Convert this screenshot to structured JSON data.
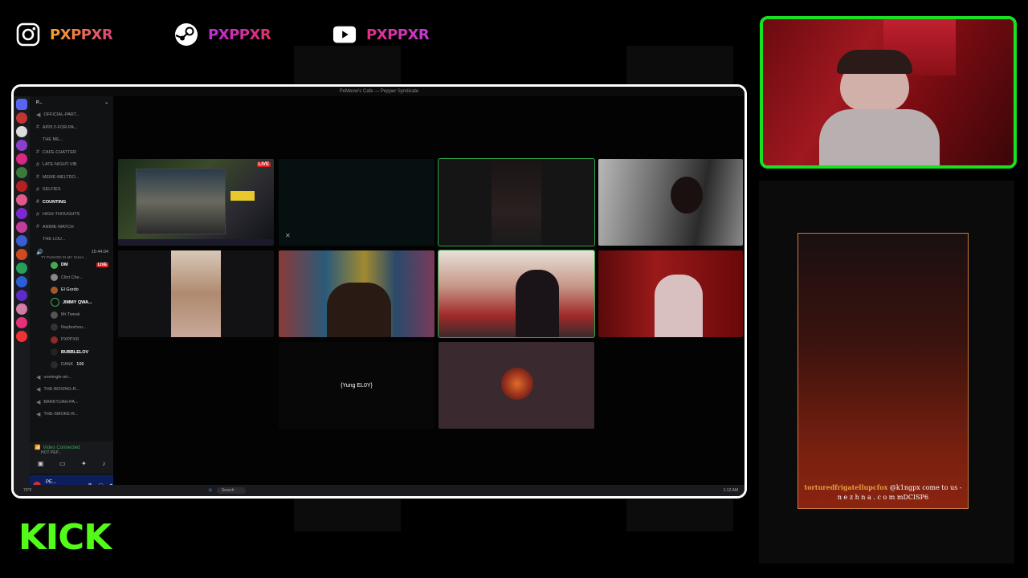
{
  "socials": [
    {
      "icon": "instagram-icon",
      "handle": "PXPPXR"
    },
    {
      "icon": "steam-icon",
      "handle": "PXPPXR"
    },
    {
      "icon": "youtube-icon",
      "handle": "PXPPXR"
    }
  ],
  "discord": {
    "window_title": "PeMeow's Cafe — Pepper Syndicate",
    "server_name": "P...",
    "channels": [
      {
        "kind": "text",
        "label": "OFFICIAL-PART..."
      },
      {
        "kind": "text",
        "label": "APPLY-FOR-PA..."
      },
      {
        "kind": "category",
        "label": "THE ME..."
      },
      {
        "kind": "text",
        "label": "CAFE-CHATTER"
      },
      {
        "kind": "text",
        "label": "LATE-NIGHT-VIB"
      },
      {
        "kind": "text",
        "label": "MEME-MELTDO..."
      },
      {
        "kind": "text",
        "label": "SELFIES"
      },
      {
        "kind": "text",
        "label": "COUNTING"
      },
      {
        "kind": "text",
        "label": "HIGH-THOUGHTS"
      },
      {
        "kind": "text",
        "label": "ANIME-WATCH"
      },
      {
        "kind": "category",
        "label": "THE LOU..."
      }
    ],
    "voice_channel": {
      "timer": "15:44:04",
      "topic": "TY PUSHED IN MY SHUA..."
    },
    "voice_users": [
      {
        "name": "DM",
        "badge": "LIVE"
      },
      {
        "name": "Clint Che..."
      },
      {
        "name": "El Gordo"
      },
      {
        "name": "JIMMY QWA..."
      },
      {
        "name": "Mr.Tweak"
      },
      {
        "name": "Nayborhoo..."
      },
      {
        "name": "PXPPXR"
      },
      {
        "name": "BUBBLELOV"
      },
      {
        "name": "DANK",
        "badge": "106"
      }
    ],
    "more_channels": [
      {
        "kind": "voice",
        "label": "unmingle-str..."
      },
      {
        "kind": "voice",
        "label": "THE-BOXING-R..."
      },
      {
        "kind": "voice",
        "label": "BARKTUAH-PA..."
      },
      {
        "kind": "voice",
        "label": "THE-SMOKE-R..."
      }
    ],
    "voice_status": "Video Connected",
    "voice_sub": "HOT PEP...",
    "user": {
      "name": "PE...",
      "status": "# Is ur"
    },
    "stage_labels": {
      "live_badge": "LIVE",
      "placeholder_name": "{Yung EL0Y}"
    },
    "taskbar": {
      "temp": "73°F",
      "search": "Search",
      "time": "1:12 AM"
    }
  },
  "chat": {
    "username": "torturedfrigatellupcfox",
    "message": "@k1ngpx come to us - n e z h n a . c o m mDCISP6"
  },
  "brand": {
    "kick_label": "KICK",
    "kick_color": "#53fc18",
    "frame_color": "#19e020"
  }
}
